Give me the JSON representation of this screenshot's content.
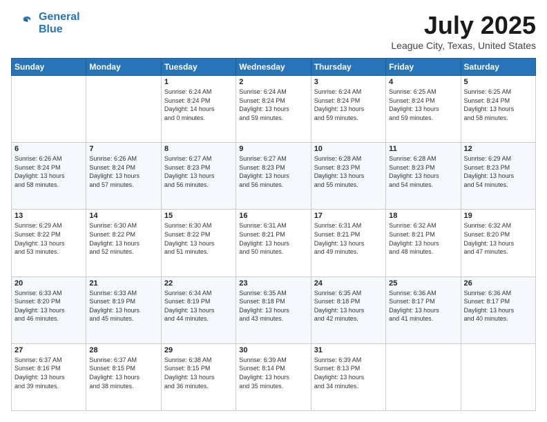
{
  "header": {
    "logo_line1": "General",
    "logo_line2": "Blue",
    "title": "July 2025",
    "subtitle": "League City, Texas, United States"
  },
  "weekdays": [
    "Sunday",
    "Monday",
    "Tuesday",
    "Wednesday",
    "Thursday",
    "Friday",
    "Saturday"
  ],
  "weeks": [
    [
      {
        "day": "",
        "info": ""
      },
      {
        "day": "",
        "info": ""
      },
      {
        "day": "1",
        "info": "Sunrise: 6:24 AM\nSunset: 8:24 PM\nDaylight: 14 hours\nand 0 minutes."
      },
      {
        "day": "2",
        "info": "Sunrise: 6:24 AM\nSunset: 8:24 PM\nDaylight: 13 hours\nand 59 minutes."
      },
      {
        "day": "3",
        "info": "Sunrise: 6:24 AM\nSunset: 8:24 PM\nDaylight: 13 hours\nand 59 minutes."
      },
      {
        "day": "4",
        "info": "Sunrise: 6:25 AM\nSunset: 8:24 PM\nDaylight: 13 hours\nand 59 minutes."
      },
      {
        "day": "5",
        "info": "Sunrise: 6:25 AM\nSunset: 8:24 PM\nDaylight: 13 hours\nand 58 minutes."
      }
    ],
    [
      {
        "day": "6",
        "info": "Sunrise: 6:26 AM\nSunset: 8:24 PM\nDaylight: 13 hours\nand 58 minutes."
      },
      {
        "day": "7",
        "info": "Sunrise: 6:26 AM\nSunset: 8:24 PM\nDaylight: 13 hours\nand 57 minutes."
      },
      {
        "day": "8",
        "info": "Sunrise: 6:27 AM\nSunset: 8:23 PM\nDaylight: 13 hours\nand 56 minutes."
      },
      {
        "day": "9",
        "info": "Sunrise: 6:27 AM\nSunset: 8:23 PM\nDaylight: 13 hours\nand 56 minutes."
      },
      {
        "day": "10",
        "info": "Sunrise: 6:28 AM\nSunset: 8:23 PM\nDaylight: 13 hours\nand 55 minutes."
      },
      {
        "day": "11",
        "info": "Sunrise: 6:28 AM\nSunset: 8:23 PM\nDaylight: 13 hours\nand 54 minutes."
      },
      {
        "day": "12",
        "info": "Sunrise: 6:29 AM\nSunset: 8:23 PM\nDaylight: 13 hours\nand 54 minutes."
      }
    ],
    [
      {
        "day": "13",
        "info": "Sunrise: 6:29 AM\nSunset: 8:22 PM\nDaylight: 13 hours\nand 53 minutes."
      },
      {
        "day": "14",
        "info": "Sunrise: 6:30 AM\nSunset: 8:22 PM\nDaylight: 13 hours\nand 52 minutes."
      },
      {
        "day": "15",
        "info": "Sunrise: 6:30 AM\nSunset: 8:22 PM\nDaylight: 13 hours\nand 51 minutes."
      },
      {
        "day": "16",
        "info": "Sunrise: 6:31 AM\nSunset: 8:21 PM\nDaylight: 13 hours\nand 50 minutes."
      },
      {
        "day": "17",
        "info": "Sunrise: 6:31 AM\nSunset: 8:21 PM\nDaylight: 13 hours\nand 49 minutes."
      },
      {
        "day": "18",
        "info": "Sunrise: 6:32 AM\nSunset: 8:21 PM\nDaylight: 13 hours\nand 48 minutes."
      },
      {
        "day": "19",
        "info": "Sunrise: 6:32 AM\nSunset: 8:20 PM\nDaylight: 13 hours\nand 47 minutes."
      }
    ],
    [
      {
        "day": "20",
        "info": "Sunrise: 6:33 AM\nSunset: 8:20 PM\nDaylight: 13 hours\nand 46 minutes."
      },
      {
        "day": "21",
        "info": "Sunrise: 6:33 AM\nSunset: 8:19 PM\nDaylight: 13 hours\nand 45 minutes."
      },
      {
        "day": "22",
        "info": "Sunrise: 6:34 AM\nSunset: 8:19 PM\nDaylight: 13 hours\nand 44 minutes."
      },
      {
        "day": "23",
        "info": "Sunrise: 6:35 AM\nSunset: 8:18 PM\nDaylight: 13 hours\nand 43 minutes."
      },
      {
        "day": "24",
        "info": "Sunrise: 6:35 AM\nSunset: 8:18 PM\nDaylight: 13 hours\nand 42 minutes."
      },
      {
        "day": "25",
        "info": "Sunrise: 6:36 AM\nSunset: 8:17 PM\nDaylight: 13 hours\nand 41 minutes."
      },
      {
        "day": "26",
        "info": "Sunrise: 6:36 AM\nSunset: 8:17 PM\nDaylight: 13 hours\nand 40 minutes."
      }
    ],
    [
      {
        "day": "27",
        "info": "Sunrise: 6:37 AM\nSunset: 8:16 PM\nDaylight: 13 hours\nand 39 minutes."
      },
      {
        "day": "28",
        "info": "Sunrise: 6:37 AM\nSunset: 8:15 PM\nDaylight: 13 hours\nand 38 minutes."
      },
      {
        "day": "29",
        "info": "Sunrise: 6:38 AM\nSunset: 8:15 PM\nDaylight: 13 hours\nand 36 minutes."
      },
      {
        "day": "30",
        "info": "Sunrise: 6:39 AM\nSunset: 8:14 PM\nDaylight: 13 hours\nand 35 minutes."
      },
      {
        "day": "31",
        "info": "Sunrise: 6:39 AM\nSunset: 8:13 PM\nDaylight: 13 hours\nand 34 minutes."
      },
      {
        "day": "",
        "info": ""
      },
      {
        "day": "",
        "info": ""
      }
    ]
  ]
}
